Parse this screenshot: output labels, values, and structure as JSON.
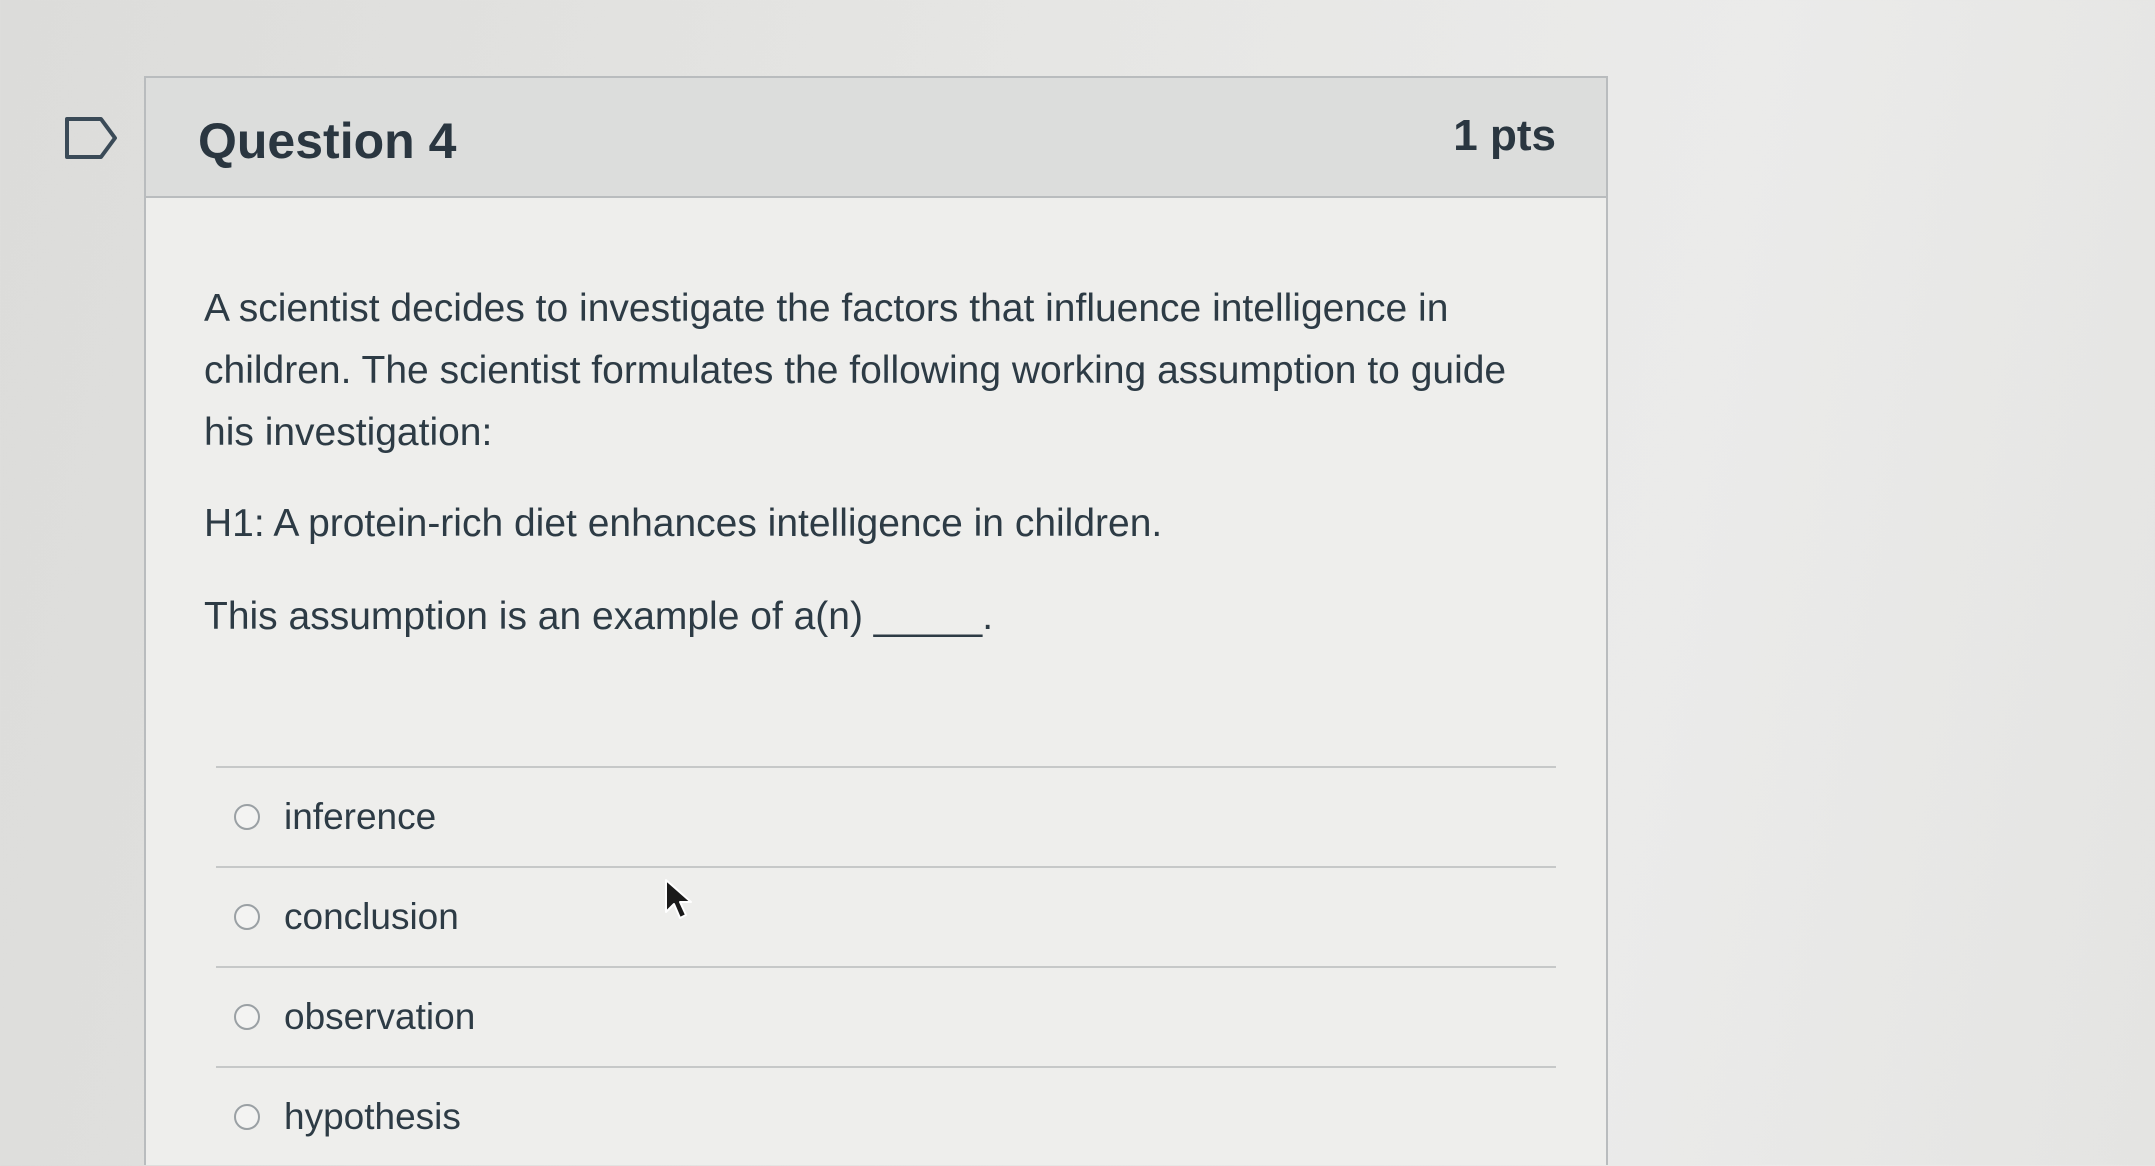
{
  "question": {
    "title": "Question 4",
    "points": "1 pts",
    "prompt": "A scientist decides to investigate the factors that influence intelligence in children. The scientist formulates the following working assumption to guide his investigation:",
    "hypothesis": "H1: A protein-rich diet enhances intelligence in children.",
    "fill_blank": "This assumption is an example of a(n) _____."
  },
  "answers": [
    {
      "label": "inference",
      "selected": false
    },
    {
      "label": "conclusion",
      "selected": false
    },
    {
      "label": "observation",
      "selected": false
    },
    {
      "label": "hypothesis",
      "selected": false
    }
  ],
  "icons": {
    "flag": "bookmark-flag-icon",
    "cursor": "mouse-pointer-icon"
  },
  "colors": {
    "text": "#2d3b45",
    "header_bg": "#dcdddc",
    "border": "#b9bcbe",
    "radio_border": "#9aa0a4"
  }
}
